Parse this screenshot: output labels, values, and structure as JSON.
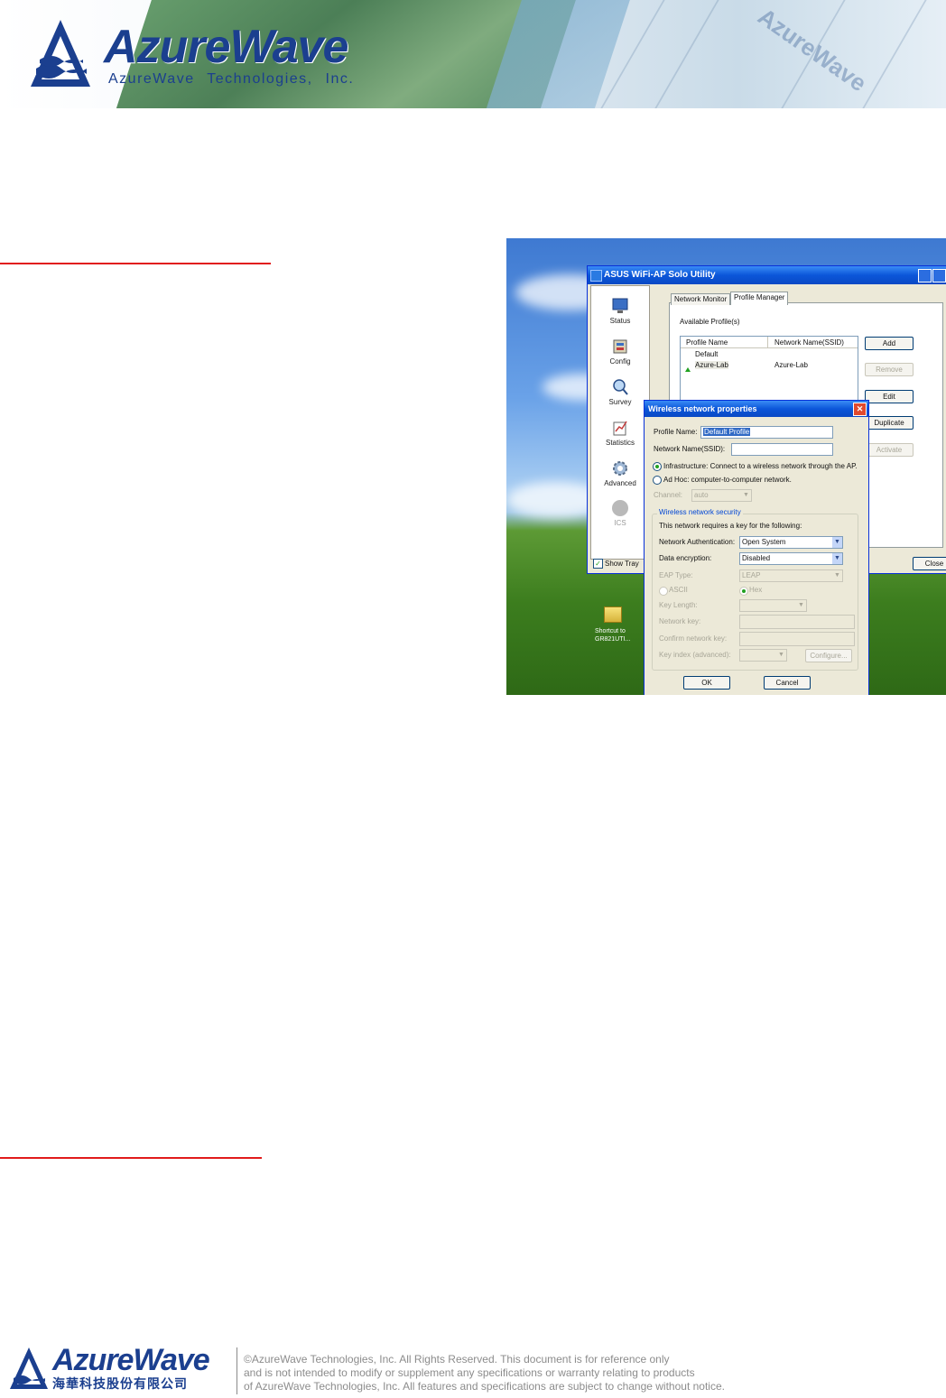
{
  "header": {
    "brand": "AzureWave",
    "company": "AzureWave Technologies, Inc.",
    "watermark": "AzureWave"
  },
  "screenshot": {
    "utility_window": {
      "title": "ASUS WiFi-AP Solo Utility",
      "sidebar": [
        {
          "label": "Status",
          "icon": "monitor-icon"
        },
        {
          "label": "Config",
          "icon": "config-icon"
        },
        {
          "label": "Survey",
          "icon": "magnifier-icon"
        },
        {
          "label": "Statistics",
          "icon": "statistics-icon"
        },
        {
          "label": "Advanced",
          "icon": "gear-icon"
        },
        {
          "label": "ICS",
          "icon": "ics-icon"
        }
      ],
      "show_tray_label": "Show Tray",
      "show_tray_checked": true,
      "tabs": [
        "Network Monitor",
        "Profile Manager"
      ],
      "active_tab": "Profile Manager",
      "available_profiles_label": "Available Profile(s)",
      "list_headers": [
        "Profile Name",
        "Network Name(SSID)"
      ],
      "profiles": [
        {
          "name": "Default",
          "ssid": ""
        },
        {
          "name": "Azure-Lab",
          "ssid": "Azure-Lab"
        }
      ],
      "buttons": {
        "add": "Add",
        "remove": "Remove",
        "edit": "Edit",
        "duplicate": "Duplicate",
        "activate": "Activate",
        "close": "Close"
      }
    },
    "dialog": {
      "title": "Wireless network properties",
      "profile_name_label": "Profile Name:",
      "profile_name_value": "Default Profile",
      "ssid_label": "Network Name(SSID):",
      "ssid_value": "",
      "infrastructure_label": "Infrastructure: Connect to a wireless network through the AP.",
      "adhoc_label": "Ad Hoc: computer-to-computer network.",
      "mode_selected": "Infrastructure",
      "channel_label": "Channel:",
      "channel_value": "auto",
      "security_group_label": "Wireless network security",
      "requires_key_label": "This network requires a key for the following:",
      "auth_label": "Network Authentication:",
      "auth_value": "Open System",
      "encryption_label": "Data encryption:",
      "encryption_value": "Disabled",
      "eap_label": "EAP Type:",
      "eap_value": "LEAP",
      "ascii_label": "ASCII",
      "hex_label": "Hex",
      "key_length_label": "Key Length:",
      "network_key_label": "Network key:",
      "confirm_key_label": "Confirm network key:",
      "key_index_label": "Key index (advanced):",
      "configure_button": "Configure...",
      "ok_button": "OK",
      "cancel_button": "Cancel"
    },
    "desktop_icon_label_1": "Shortcut to",
    "desktop_icon_label_2": "GR821UTI..."
  },
  "footer": {
    "brand": "AzureWave",
    "brand_cn": "海華科技股份有限公司",
    "lines": [
      "©AzureWave Technologies, Inc. All Rights Reserved. This document is for reference only",
      "and is not intended to modify or supplement any specifications or  warranty relating to products",
      "of AzureWave Technologies, Inc.  All features and specifications are subject to change without notice."
    ]
  },
  "colors": {
    "brand_blue": "#1b3f8f",
    "rule_red": "#e11b1b",
    "xp_title_blue": "#0b56d9"
  }
}
